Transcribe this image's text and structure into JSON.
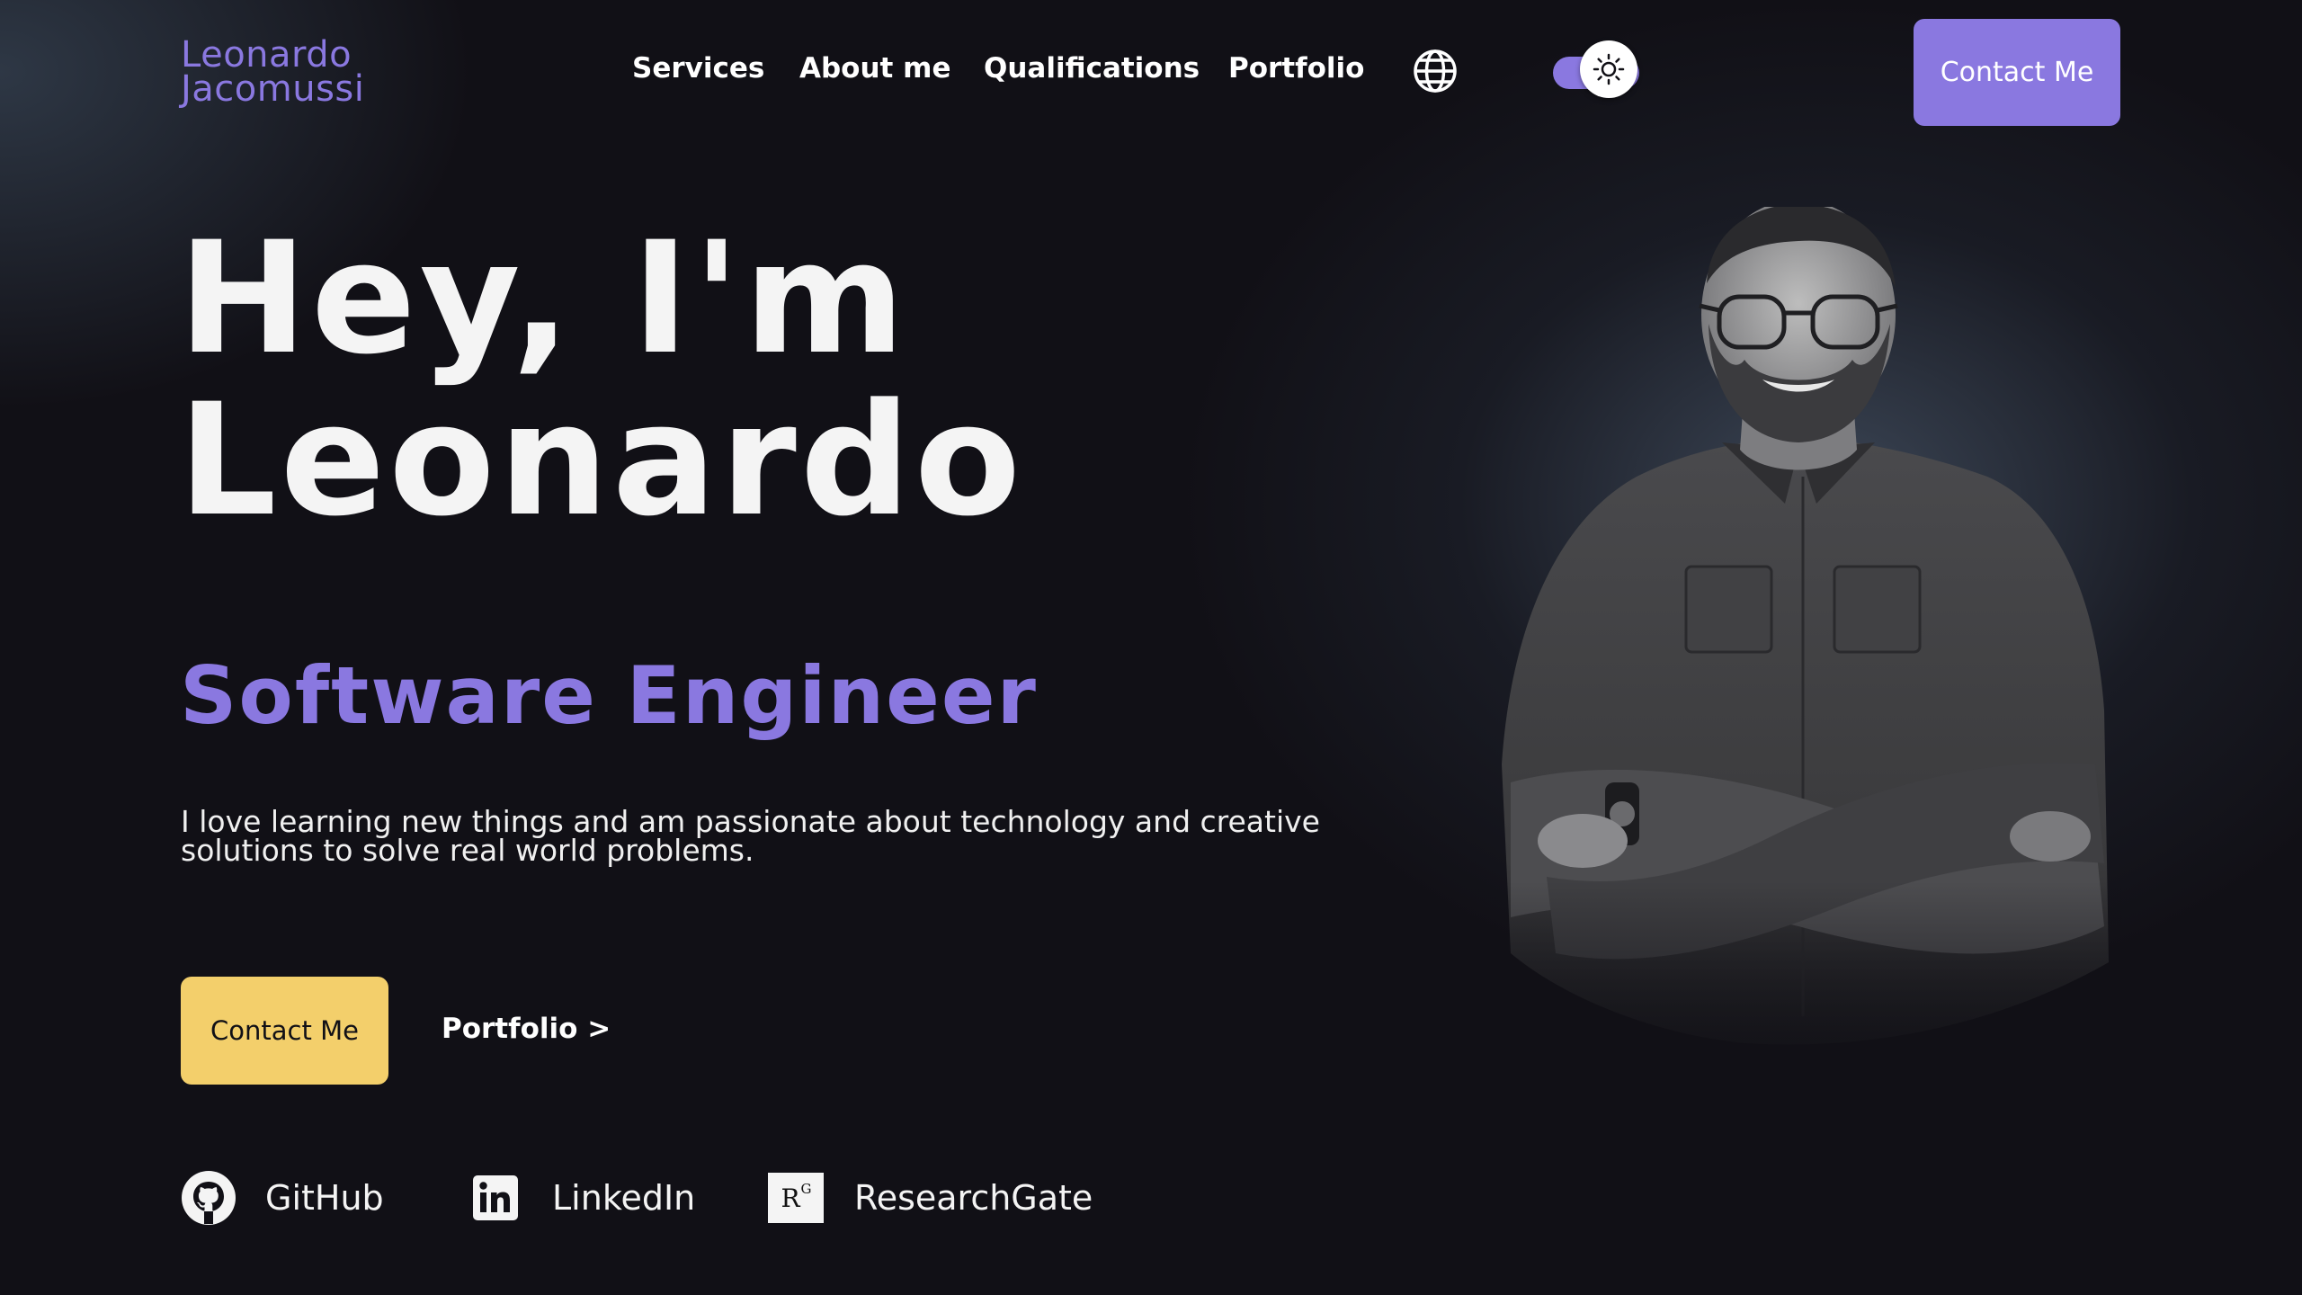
{
  "header": {
    "logo_line1": "Leonardo",
    "logo_line2": "Jacomussi",
    "nav": [
      "Services",
      "About me",
      "Qualifications",
      "Portfolio"
    ],
    "language_icon": "globe-icon",
    "theme_toggle_icon": "sun-icon",
    "cta_label": "Contact Me"
  },
  "hero": {
    "title_line1": "Hey, I'm",
    "title_line2": "Leonardo",
    "subtitle": "Software Engineer",
    "description": "I love learning new things and am passionate about technology and creative solutions to solve real world problems.",
    "primary_cta": "Contact Me",
    "secondary_cta": "Portfolio >"
  },
  "socials": [
    {
      "label": "GitHub",
      "icon": "github-icon"
    },
    {
      "label": "LinkedIn",
      "icon": "linkedin-icon"
    },
    {
      "label": "ResearchGate",
      "icon": "researchgate-icon",
      "icon_text": "R",
      "icon_sup": "G"
    }
  ],
  "colors": {
    "background": "#111016",
    "accent_purple": "#8a78e0",
    "accent_yellow": "#f3cf6b",
    "text": "#f4f4f4"
  }
}
